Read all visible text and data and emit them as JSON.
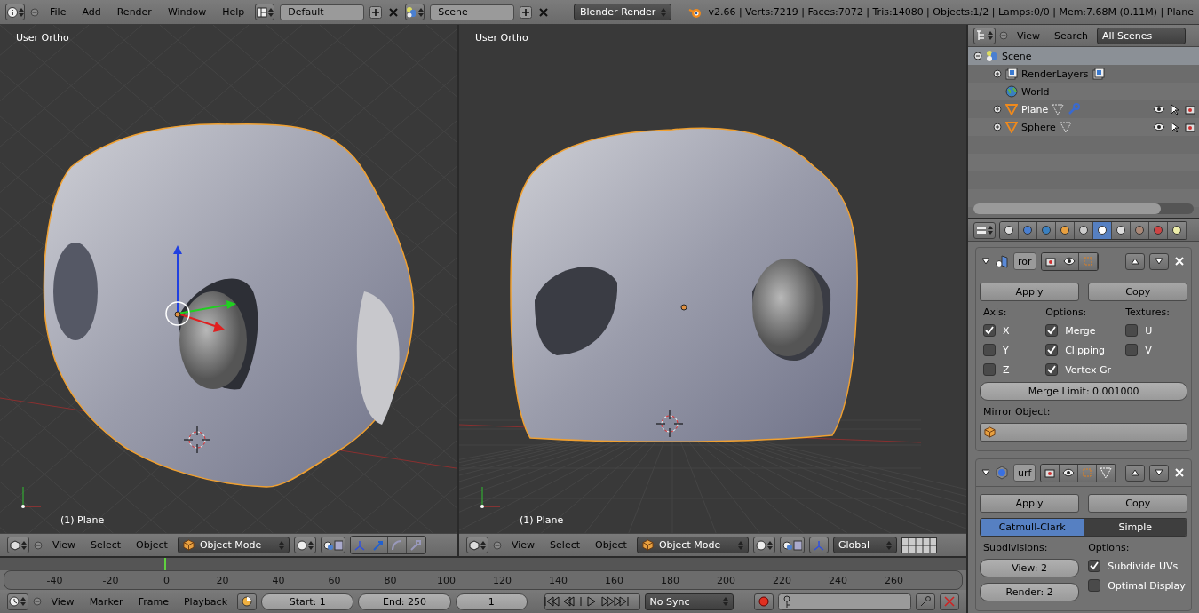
{
  "top_bar": {
    "menus": [
      "File",
      "Add",
      "Render",
      "Window",
      "Help"
    ],
    "layout": "Default",
    "scene": "Scene",
    "engine": "Blender Render",
    "stats": "v2.66 | Verts:7219 | Faces:7072 | Tris:14080 | Objects:1/2 | Lamps:0/0 | Mem:7.68M (0.11M) | Plane"
  },
  "viewports": [
    {
      "view_label": "User Ortho",
      "object_label": "(1) Plane",
      "kind": "angled",
      "menus": [
        "View",
        "Select",
        "Object"
      ],
      "mode": "Object Mode"
    },
    {
      "view_label": "User Ortho",
      "object_label": "(1) Plane",
      "kind": "front",
      "menus": [
        "View",
        "Select",
        "Object"
      ],
      "mode": "Object Mode",
      "orientation": "Global"
    }
  ],
  "outliner": {
    "menus": [
      "View",
      "Search"
    ],
    "filter": "All Scenes",
    "tree": [
      {
        "label": "Scene",
        "kind": "scene",
        "selected": true,
        "children": [
          {
            "label": "RenderLayers",
            "kind": "layers",
            "selected": false
          },
          {
            "label": "World",
            "kind": "world",
            "selected": false
          },
          {
            "label": "Plane",
            "kind": "mesh",
            "selected": false,
            "active": true,
            "modifier": true,
            "restrict": true
          },
          {
            "label": "Sphere",
            "kind": "mesh",
            "selected": false,
            "active": false,
            "modifier": false,
            "restrict": true
          }
        ]
      }
    ]
  },
  "properties": {
    "tabs": [
      {
        "kind": "render",
        "selected": false
      },
      {
        "kind": "scene",
        "selected": false
      },
      {
        "kind": "world",
        "selected": false
      },
      {
        "kind": "object",
        "selected": false
      },
      {
        "kind": "constraints",
        "selected": false
      },
      {
        "kind": "modifiers",
        "selected": true
      },
      {
        "kind": "data",
        "selected": false
      },
      {
        "kind": "material",
        "selected": false
      },
      {
        "kind": "texture",
        "selected": false
      },
      {
        "kind": "particles",
        "selected": false
      }
    ],
    "modifiers": [
      {
        "kind": "mirror",
        "name": "ror",
        "apply": "Apply",
        "copy": "Copy",
        "groups": [
          {
            "label": "Axis:",
            "items": [
              {
                "label": "X",
                "checked": true
              },
              {
                "label": "Y",
                "checked": false
              },
              {
                "label": "Z",
                "checked": false
              }
            ]
          },
          {
            "label": "Options:",
            "items": [
              {
                "label": "Merge",
                "checked": true
              },
              {
                "label": "Clipping",
                "checked": true
              },
              {
                "label": "Vertex Gr",
                "checked": true
              }
            ]
          },
          {
            "label": "Textures:",
            "items": [
              {
                "label": "U",
                "checked": false
              },
              {
                "label": "V",
                "checked": false
              }
            ]
          }
        ],
        "merge_limit": "Merge Limit: 0.001000",
        "mirror_object_label": "Mirror Object:"
      },
      {
        "kind": "subsurf",
        "name": "urf",
        "apply": "Apply",
        "copy": "Copy",
        "types": [
          {
            "label": "Catmull-Clark",
            "selected": true
          },
          {
            "label": "Simple",
            "selected": false
          }
        ],
        "subdivisions_label": "Subdivisions:",
        "view": "View: 2",
        "render": "Render: 2",
        "options_label": "Options:",
        "options": [
          {
            "label": "Subdivide UVs",
            "checked": true
          },
          {
            "label": "Optimal Display",
            "checked": false
          }
        ]
      }
    ]
  },
  "timeline": {
    "ticks": [
      "-40",
      "-20",
      "0",
      "20",
      "40",
      "60",
      "80",
      "100",
      "120",
      "140",
      "160",
      "180",
      "200",
      "220",
      "240",
      "260"
    ],
    "menus": [
      "View",
      "Marker",
      "Frame",
      "Playback"
    ],
    "start": "Start: 1",
    "end": "End: 250",
    "frame": "1",
    "sync": "No Sync"
  }
}
